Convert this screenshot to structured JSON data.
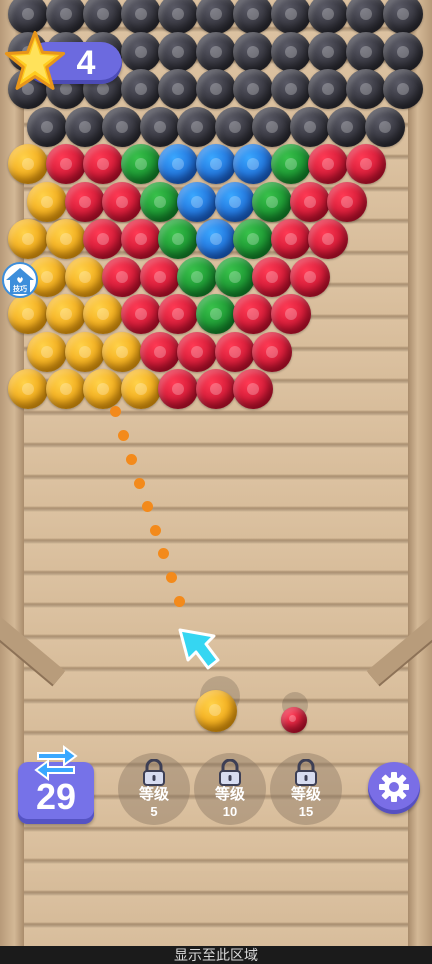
{
  "hud": {
    "score": "4",
    "tips_label": "技巧"
  },
  "swap": {
    "count": "29"
  },
  "locked_levels": [
    {
      "label": "等级",
      "level": "5"
    },
    {
      "label": "等级",
      "level": "10"
    },
    {
      "label": "等级",
      "level": "15"
    }
  ],
  "footer": {
    "text": "显示至此区域"
  },
  "colors": {
    "accent": "#6c6adf",
    "aim_dots": "#f38a1b",
    "arrow": "#35d6f2",
    "board": "#d4b896"
  },
  "icons": {
    "score": "star-icon",
    "tips": "house-icon",
    "swap": "swap-arrows-icon",
    "lock": "lock-icon",
    "settings": "gear-icon",
    "aim": "arrow-icon"
  },
  "board": {
    "rows": [
      [
        "dark",
        "dark",
        "dark",
        "dark",
        "dark",
        "dark",
        "dark",
        "dark",
        "dark",
        "dark",
        "dark"
      ],
      [
        "dark",
        "dark",
        "dark",
        "dark",
        "dark",
        "dark",
        "dark",
        "dark",
        "dark",
        "dark",
        "dark"
      ],
      [
        "dark",
        "dark",
        "dark",
        "dark",
        "dark",
        "dark",
        "dark",
        "dark",
        "dark",
        "dark",
        "dark"
      ],
      [
        "dark",
        "dark",
        "dark",
        "dark",
        "dark",
        "dark",
        "dark",
        "dark",
        "dark",
        "dark"
      ],
      [
        "yellow",
        "red",
        "red",
        "green",
        "blue",
        "blue",
        "blue",
        "green",
        "red",
        "red"
      ],
      [
        "yellow",
        "red",
        "red",
        "green",
        "blue",
        "blue",
        "green",
        "red",
        "red"
      ],
      [
        "yellow",
        "yellow",
        "red",
        "red",
        "green",
        "blue",
        "green",
        "red",
        "red"
      ],
      [
        "yellow",
        "yellow",
        "red",
        "red",
        "green",
        "green",
        "red",
        "red"
      ],
      [
        "yellow",
        "yellow",
        "yellow",
        "red",
        "red",
        "green",
        "red",
        "red"
      ],
      [
        "yellow",
        "yellow",
        "yellow",
        "red",
        "red",
        "red",
        "red"
      ],
      [
        "yellow",
        "yellow",
        "yellow",
        "yellow",
        "red",
        "red",
        "red"
      ]
    ],
    "shooter_ball": "yellow",
    "next_ball": "red"
  }
}
